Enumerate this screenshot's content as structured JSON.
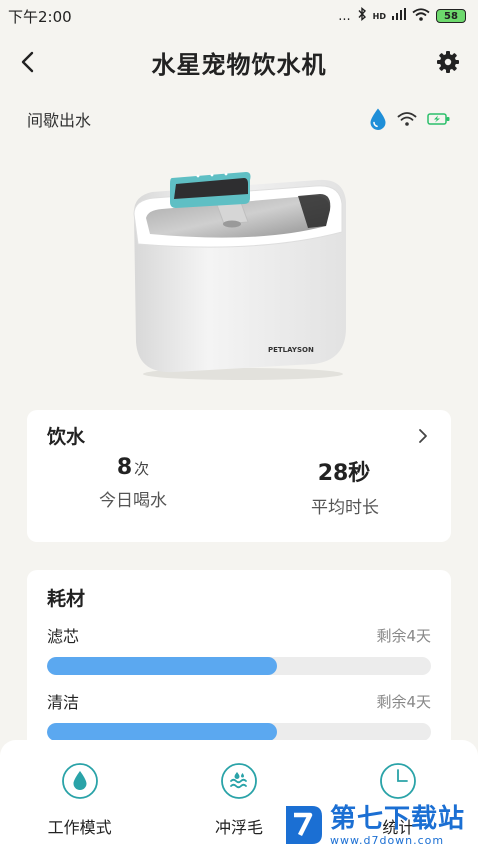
{
  "status_bar": {
    "time": "下午2:00",
    "signal_text": "...",
    "network": "HD",
    "battery": "58"
  },
  "header": {
    "title": "水星宠物饮水机"
  },
  "mode": {
    "label": "间歇出水"
  },
  "device": {
    "brand_text": "PETLAYSON"
  },
  "drink_card": {
    "title": "饮水",
    "stats": [
      {
        "value": "8",
        "unit": "次",
        "label": "今日喝水"
      },
      {
        "value": "28秒",
        "unit": "",
        "label": "平均时长"
      }
    ]
  },
  "consumables_card": {
    "title": "耗材",
    "items": [
      {
        "name": "滤芯",
        "remain": "剩余4天",
        "progress": 0.6
      },
      {
        "name": "清洁",
        "remain": "剩余4天",
        "progress": 0.6
      }
    ]
  },
  "bottom_nav": [
    {
      "label": "工作模式",
      "icon": "water-drop-icon"
    },
    {
      "label": "冲浮毛",
      "icon": "wave-icon"
    },
    {
      "label": "统计",
      "icon": "clock-icon"
    }
  ],
  "watermark": {
    "title": "第七下载站",
    "url": "www.d7down.com"
  },
  "colors": {
    "accent": "#5ba8f0",
    "icon_teal": "#2aa3a8",
    "background": "#f5f4f0"
  }
}
